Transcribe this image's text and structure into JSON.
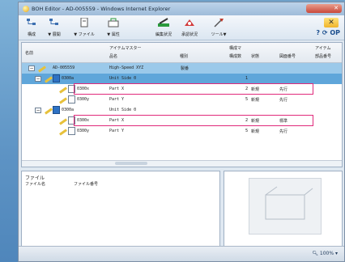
{
  "window": {
    "title": "BOH Editor - AD-005559 - Windows Internet Explorer"
  },
  "toolbar": {
    "items": [
      {
        "label": "構成",
        "icon": "structure-icon"
      },
      {
        "label": "展開",
        "icon": "expand-icon"
      },
      {
        "label": "ファイル",
        "icon": "file-icon"
      },
      {
        "label": "属性",
        "icon": "attribute-icon"
      },
      {
        "label": "編集状況",
        "icon": "edit-status-icon"
      },
      {
        "label": "承認状況",
        "icon": "approval-status-icon"
      },
      {
        "label": "ツール",
        "icon": "tools-icon"
      }
    ],
    "right_icons": "? ⟳ OP",
    "close_label": "✕"
  },
  "grid": {
    "headers": {
      "name": "名前",
      "item_master": "アイテムマスター",
      "part_name": "品名",
      "category": "種別",
      "composition": "構成マ",
      "quantity": "構成数",
      "status": "状態",
      "drawing_no": "図面番号",
      "item_trailing": "アイテム",
      "part_no_trailing": "部品番号"
    },
    "rows": [
      {
        "id": "AD-005559",
        "name": "High-Speed XYZ",
        "col_category": "製番",
        "qty": "",
        "status": "",
        "ref": ""
      },
      {
        "id": "0300a",
        "name": "Unit Side 0",
        "col_category": "",
        "qty": "1",
        "status": "",
        "ref": ""
      },
      {
        "id": "0300x",
        "name": "Part X",
        "col_category": "",
        "qty": "2",
        "status": "新規",
        "ref": "先行"
      },
      {
        "id": "0300y",
        "name": "Part Y",
        "col_category": "",
        "qty": "5",
        "status": "新規",
        "ref": "先行"
      },
      {
        "id": "0300a",
        "name": "Unit Side 0",
        "col_category": "",
        "qty": "",
        "status": "",
        "ref": ""
      },
      {
        "id": "0300x",
        "name": "Part X",
        "col_category": "",
        "qty": "2",
        "status": "新規",
        "ref": "標準"
      },
      {
        "id": "0300y",
        "name": "Part Y",
        "col_category": "",
        "qty": "5",
        "status": "新規",
        "ref": "先行"
      }
    ]
  },
  "file_panel": {
    "title": "ファイル",
    "col_filename": "ファイル名",
    "col_fileno": "ファイル番号"
  },
  "status_bar": {
    "zoom": "100%"
  },
  "colors": {
    "selection": "#5fa6da",
    "selection_light": "#9bc9ea",
    "highlight": "#e02a7b"
  }
}
